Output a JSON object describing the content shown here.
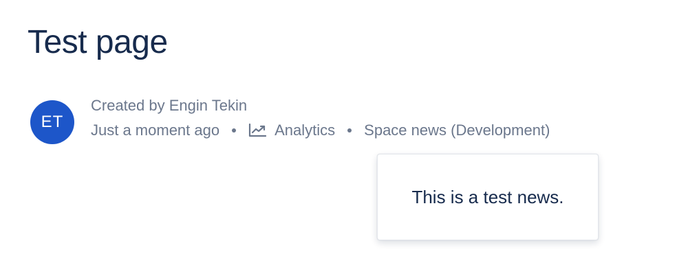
{
  "page": {
    "title": "Test page"
  },
  "author": {
    "initials": "ET",
    "created_by": "Created by Engin Tekin",
    "avatar_color": "#1d56c9"
  },
  "meta": {
    "timestamp": "Just a moment ago",
    "analytics_label": "Analytics",
    "analytics_icon": "trend-up-icon",
    "space_news_label": "Space news (Development)"
  },
  "popup": {
    "text": "This is a test news."
  },
  "colors": {
    "title": "#172b4d",
    "meta_text": "#6b778c"
  }
}
